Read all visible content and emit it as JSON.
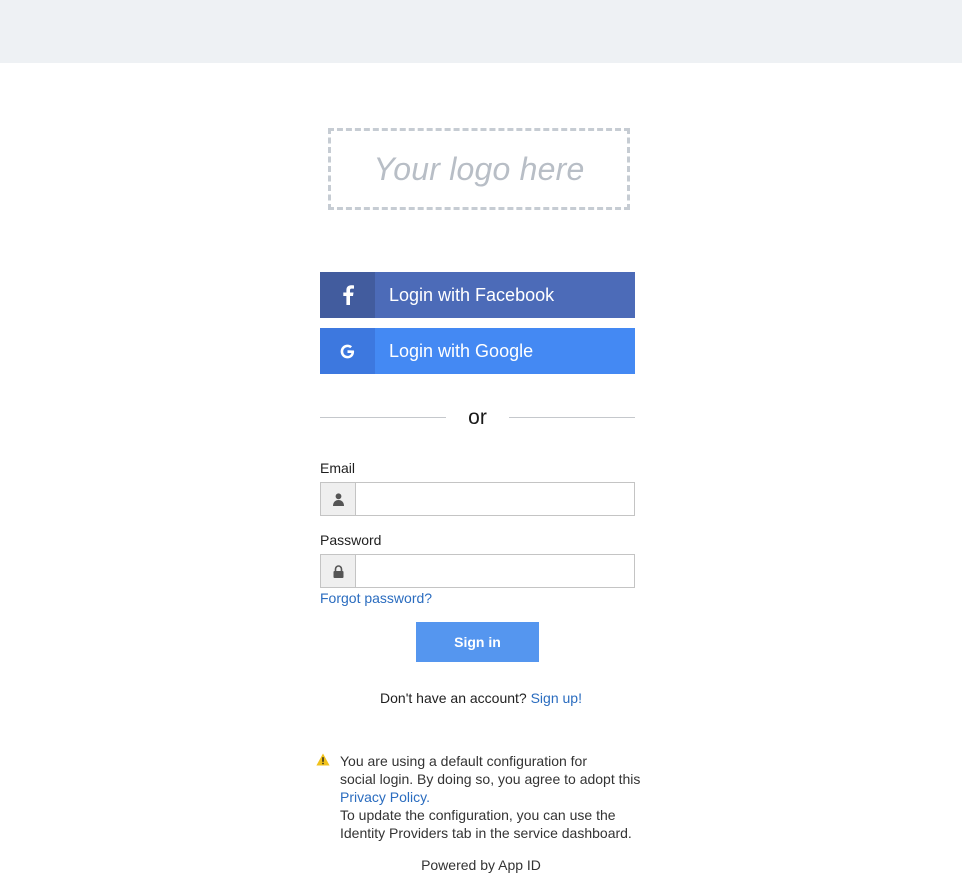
{
  "logo": {
    "placeholder": "Your logo here"
  },
  "social": {
    "facebook": {
      "icon": "facebook-icon",
      "label": "Login with Facebook",
      "color": "#4c6bb8"
    },
    "google": {
      "icon": "google-icon",
      "label": "Login with Google",
      "color": "#4489f3"
    }
  },
  "divider": {
    "text": "or"
  },
  "form": {
    "email": {
      "label": "Email",
      "icon": "user-icon",
      "value": ""
    },
    "password": {
      "label": "Password",
      "icon": "lock-icon",
      "value": ""
    },
    "forgot": "Forgot password?",
    "submit": "Sign in"
  },
  "signup": {
    "prompt": "Don't have an account?",
    "link": "Sign up!"
  },
  "notice": {
    "icon": "warning-icon",
    "line1": "You are using a default configuration for",
    "line2": "social login. By doing so, you agree to adopt this",
    "policy_link": "Privacy Policy.",
    "line3": "To update the configuration, you can use the",
    "line4": "Identity Providers tab in the service dashboard."
  },
  "footer": {
    "powered": "Powered by App ID"
  },
  "colors": {
    "accent": "#5596ef",
    "link": "#2a6cbf",
    "warning": "#f1c21b"
  }
}
